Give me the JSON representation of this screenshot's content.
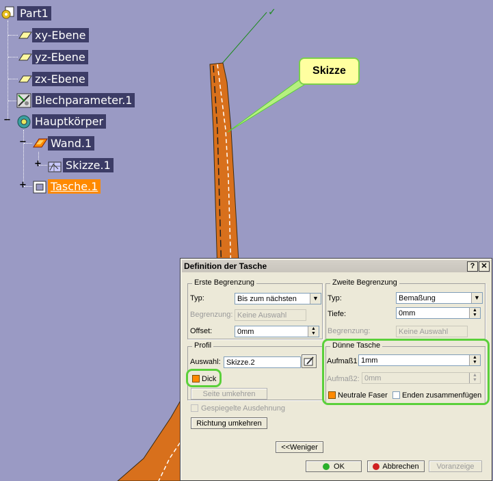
{
  "tree": {
    "root": "Part1",
    "plane_xy": "xy-Ebene",
    "plane_yz": "yz-Ebene",
    "plane_zx": "zx-Ebene",
    "sheet_params": "Blechparameter.1",
    "body": "Hauptkörper",
    "wall": "Wand.1",
    "sketch": "Skizze.1",
    "pocket": "Tasche.1"
  },
  "callout": {
    "text": "Skizze"
  },
  "dialog": {
    "title": "Definition der Tasche",
    "help_btn": "?",
    "close_btn": "✕",
    "first_limit": {
      "legend": "Erste Begrenzung",
      "type_label": "Typ:",
      "type_value": "Bis zum nächsten",
      "limit_label": "Begrenzung:",
      "limit_value": "Keine Auswahl",
      "offset_label": "Offset:",
      "offset_value": "0mm"
    },
    "profile": {
      "legend": "Profil",
      "selection_label": "Auswahl:",
      "selection_value": "Skizze.2",
      "thick_label": "Dick",
      "reverse_side": "Seite umkehren"
    },
    "mirrored_label": "Gespiegelte Ausdehnung",
    "reverse_direction": "Richtung umkehren",
    "second_limit": {
      "legend": "Zweite Begrenzung",
      "type_label": "Typ:",
      "type_value": "Bemaßung",
      "depth_label": "Tiefe:",
      "depth_value": "0mm",
      "limit_label": "Begrenzung:",
      "limit_value": "Keine Auswahl"
    },
    "thin_pocket": {
      "legend": "Dünne Tasche",
      "thickness1_label": "Aufmaß1",
      "thickness1_value": "1mm",
      "thickness2_label": "Aufmaß2:",
      "thickness2_value": "0mm",
      "neutral_fiber": "Neutrale Faser",
      "merge_ends": "Enden zusammenfügen"
    },
    "less_button": "<<Weniger",
    "ok_button": "OK",
    "cancel_button": "Abbrechen",
    "preview_button": "Voranzeige"
  },
  "colors": {
    "background": "#9a9ac4",
    "tree_label_bg": "#3c3c66",
    "active_label_bg": "#ff8a00",
    "highlight": "#5ad03a",
    "part_fill": "#d8701c"
  }
}
